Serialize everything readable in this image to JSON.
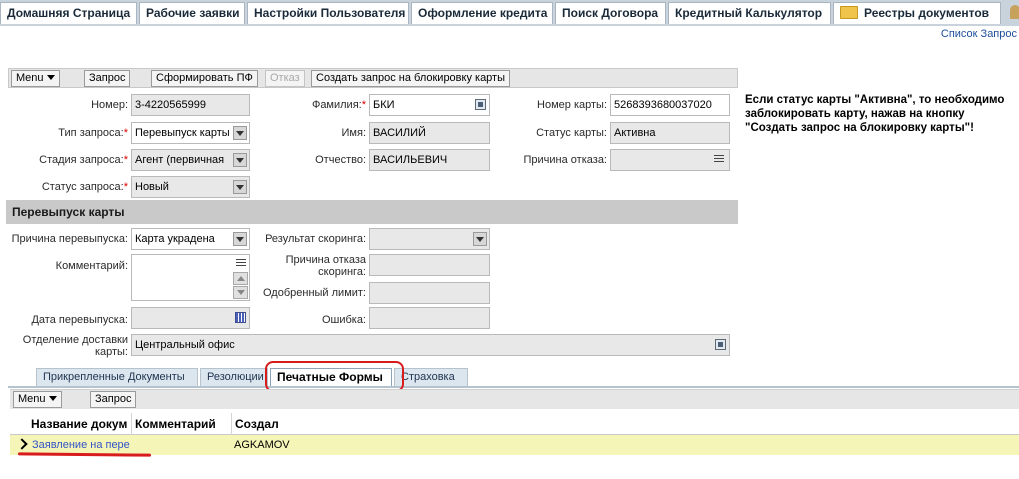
{
  "nav": {
    "tabs": [
      {
        "label": "Домашняя Страница"
      },
      {
        "label": "Рабочие заявки"
      },
      {
        "label": "Настройки Пользователя"
      },
      {
        "label": "Оформление кредита"
      },
      {
        "label": "Поиск Договора"
      },
      {
        "label": "Кредитный Калькулятор"
      },
      {
        "label": "Реестры документов"
      }
    ],
    "right_link": "Список Запрос"
  },
  "toolbar": {
    "menu_label": "Menu",
    "request_label": "Запрос",
    "generate_label": "Сформировать ПФ",
    "refuse_label": "Отказ",
    "block_card_label": "Создать запрос на блокировку карты"
  },
  "form": {
    "number": {
      "label": "Номер:",
      "value": "3-4220565999"
    },
    "request_type": {
      "label": "Тип запроса:",
      "value": "Перевыпуск карты"
    },
    "request_stage": {
      "label": "Стадия запроса:",
      "value": "Агент (первичная"
    },
    "request_status": {
      "label": "Статус запроса:",
      "value": "Новый"
    },
    "last_name": {
      "label": "Фамилия:",
      "value": "БКИ"
    },
    "first_name": {
      "label": "Имя:",
      "value": "ВАСИЛИЙ"
    },
    "patronymic": {
      "label": "Отчество:",
      "value": "ВАСИЛЬЕВИЧ"
    },
    "card_number": {
      "label": "Номер карты:",
      "value": "5268393680037020"
    },
    "card_status": {
      "label": "Статус карты:",
      "value": "Активна"
    },
    "refusal_reason": {
      "label": "Причина отказа:",
      "value": ""
    },
    "required_mark": "*"
  },
  "note": "Если статус карты \"Активна\", то необходимо заблокировать карту, нажав на кнопку \"Создать запрос на блокировку карты\"!",
  "reissue": {
    "section_title": "Перевыпуск карты",
    "reason": {
      "label": "Причина перевыпуска:",
      "value": "Карта украдена"
    },
    "comment": {
      "label": "Комментарий:",
      "value": ""
    },
    "reissue_date": {
      "label": "Дата перевыпуска:",
      "value": ""
    },
    "delivery_office": {
      "label": "Отделение доставки карты:",
      "value": "Центральный офис"
    },
    "scoring_result": {
      "label": "Результат скоринга:",
      "value": ""
    },
    "scoring_refusal": {
      "label": "Причина отказа скоринга:",
      "value": ""
    },
    "approved_limit": {
      "label": "Одобренный лимит:",
      "value": ""
    },
    "error": {
      "label": "Ошибка:",
      "value": ""
    }
  },
  "tabs": [
    {
      "label": "Прикрепленные Документы"
    },
    {
      "label": "Резолюции"
    },
    {
      "label": "Печатные Формы"
    },
    {
      "label": "Страховка"
    }
  ],
  "subtoolbar": {
    "menu_label": "Menu",
    "request_label": "Запрос"
  },
  "table": {
    "columns": [
      "Название докум",
      "Комментарий",
      "Создал"
    ],
    "rows": [
      {
        "name": "Заявление на пере",
        "comment": "",
        "created_by": "AGKAMOV"
      }
    ]
  }
}
